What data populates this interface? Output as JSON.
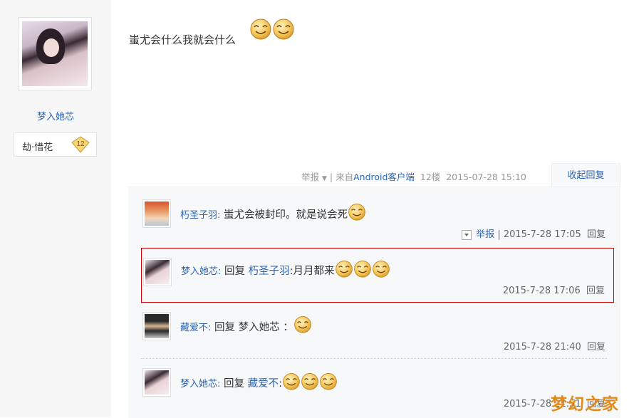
{
  "author": {
    "username": "梦入她芯",
    "badge_name": "劫·惜花",
    "badge_level": "12"
  },
  "post": {
    "text": "蚩尤会什么我就会什么",
    "emoji_count": 2,
    "meta": {
      "report": "举报",
      "source_prefix": "| 来自",
      "source": "Android客户端",
      "floor": "12楼",
      "time": "2015-07-28 15:10"
    },
    "collapse_label": "收起回复"
  },
  "replies": [
    {
      "user": "朽圣子羽:",
      "text": "蚩尤会被封印。就是说会死",
      "report": "举报",
      "time": "| 2015-7-28 17:05",
      "reply_label": "回复"
    },
    {
      "user": "梦入她芯:",
      "prefix": "回复",
      "target": "朽圣子羽",
      "text": ":月月都来",
      "time": "2015-7-28 17:06",
      "reply_label": "回复"
    },
    {
      "user": "藏爱不:",
      "prefix": "回复",
      "target": "梦入她芯",
      "text": "：",
      "time": "2015-7-28 21:40",
      "reply_label": "回复"
    },
    {
      "user": "梦入她芯:",
      "prefix": "回复",
      "target": "藏爱不",
      "text": ":",
      "time": "2015-7-28 21:51",
      "reply_label": "回复"
    }
  ],
  "watermark": "梦幻之家",
  "colors": {
    "link": "#2d64b3",
    "highlight_border": "#cc0000",
    "watermark": "#e38b1a"
  }
}
